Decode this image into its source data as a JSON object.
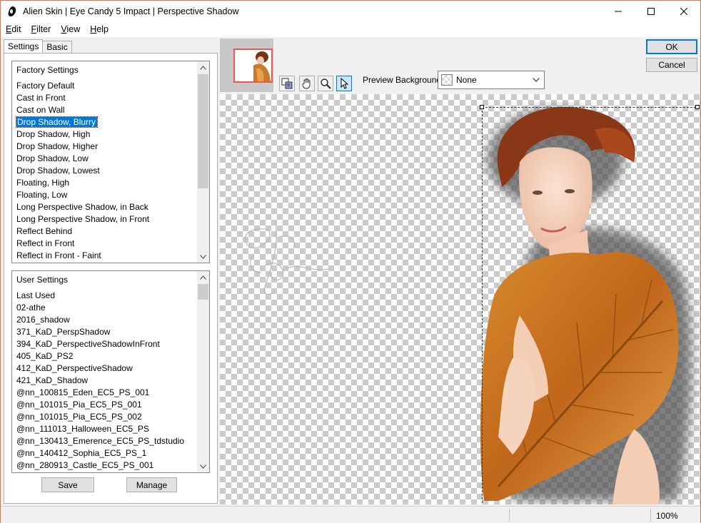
{
  "window": {
    "title": "Alien Skin | Eye Candy 5 Impact | Perspective Shadow"
  },
  "menu": [
    {
      "label": "Edit",
      "mnemonic": "E",
      "rest": "dit"
    },
    {
      "label": "Filter",
      "mnemonic": "F",
      "rest": "ilter"
    },
    {
      "label": "View",
      "mnemonic": "V",
      "rest": "iew"
    },
    {
      "label": "Help",
      "mnemonic": "H",
      "rest": "elp"
    }
  ],
  "tabs": {
    "settings": "Settings",
    "basic": "Basic"
  },
  "factory": {
    "header": "Factory Settings",
    "items": [
      "Factory Default",
      "Cast in Front",
      "Cast on Wall",
      "Drop Shadow, Blurry",
      "Drop Shadow, High",
      "Drop Shadow, Higher",
      "Drop Shadow, Low",
      "Drop Shadow, Lowest",
      "Floating, High",
      "Floating, Low",
      "Long Perspective Shadow, in Back",
      "Long Perspective Shadow, in Front",
      "Reflect Behind",
      "Reflect in Front",
      "Reflect in Front - Faint"
    ],
    "selected_index": 3
  },
  "user": {
    "header": "User Settings",
    "items": [
      "Last Used",
      "02-athe",
      "2016_shadow",
      "371_KaD_PerspShadow",
      "394_KaD_PerspectiveShadowInFront",
      "405_KaD_PS2",
      "412_KaD_PerspectiveShadow",
      "421_KaD_Shadow",
      "@nn_100815_Eden_EC5_PS_001",
      "@nn_101015_Pia_EC5_PS_001",
      "@nn_101015_Pia_EC5_PS_002",
      "@nn_111013_Halloween_EC5_PS",
      "@nn_130413_Emerence_EC5_PS_tdstudio",
      "@nn_140412_Sophia_EC5_PS_1",
      "@nn_280913_Castle_EC5_PS_001"
    ]
  },
  "buttons": {
    "save": "Save",
    "manage": "Manage",
    "ok": "OK",
    "cancel": "Cancel"
  },
  "preview": {
    "background_label": "Preview Background:",
    "background_value": "None"
  },
  "status": {
    "zoom": "100%"
  },
  "colors": {
    "accent": "#0078d7",
    "selection_bg": "#0078d7",
    "frame_border": "#d47a4a"
  },
  "icons": [
    "app-icon",
    "minimize-icon",
    "maximize-icon",
    "close-icon",
    "before-after-icon",
    "hand-icon",
    "zoom-icon",
    "pointer-icon",
    "chevron-down-icon",
    "scroll-up-icon",
    "scroll-down-icon"
  ]
}
